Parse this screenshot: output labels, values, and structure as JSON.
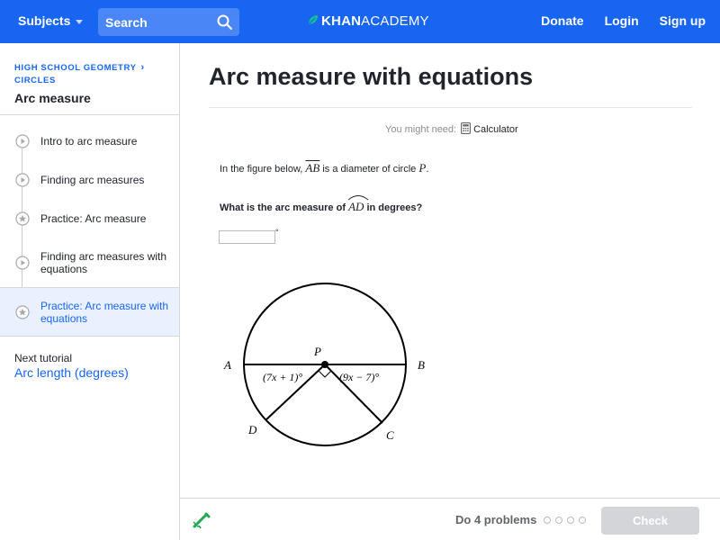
{
  "nav": {
    "subjects_label": "Subjects",
    "search_placeholder": "Search",
    "logo_prefix": "KHAN",
    "logo_suffix": "ACADEMY",
    "donate": "Donate",
    "login": "Login",
    "signup": "Sign up"
  },
  "sidebar": {
    "breadcrumb_course": "HIGH SCHOOL GEOMETRY",
    "breadcrumb_unit": "CIRCLES",
    "unit_title": "Arc measure",
    "items": [
      {
        "label": "Intro to arc measure",
        "icon": "play-icon"
      },
      {
        "label": "Finding arc measures",
        "icon": "play-icon"
      },
      {
        "label": "Practice: Arc measure",
        "icon": "star-icon"
      },
      {
        "label": "Finding arc measures with equations",
        "icon": "play-icon"
      },
      {
        "label": "Practice: Arc measure with equations",
        "icon": "star-icon",
        "active": true
      }
    ],
    "next_label": "Next tutorial",
    "next_link": "Arc length (degrees)"
  },
  "exercise": {
    "title": "Arc measure with equations",
    "need_label": "You might need:",
    "calculator": "Calculator",
    "q1_pre": "In the figure below,",
    "q1_seg": "AB",
    "q1_mid": "is a diameter of circle",
    "q1_circle": "P",
    "q1_end": ".",
    "q2_pre": "What is the arc measure of",
    "q2_arc": "AD",
    "q2_post": "in degrees?",
    "answer_value": "",
    "degree_symbol": "°"
  },
  "figure": {
    "points": {
      "A": "A",
      "B": "B",
      "C": "C",
      "D": "D",
      "P": "P"
    },
    "angle_left": "(7x + 1)°",
    "angle_right": "(9x − 7)°"
  },
  "footer": {
    "do_problems": "Do 4 problems",
    "check": "Check"
  },
  "colors": {
    "brand": "#1865f2",
    "active_bg": "#eaf1fe",
    "scratchpad": "#1fab54",
    "check_disabled": "#d3d5d8"
  }
}
